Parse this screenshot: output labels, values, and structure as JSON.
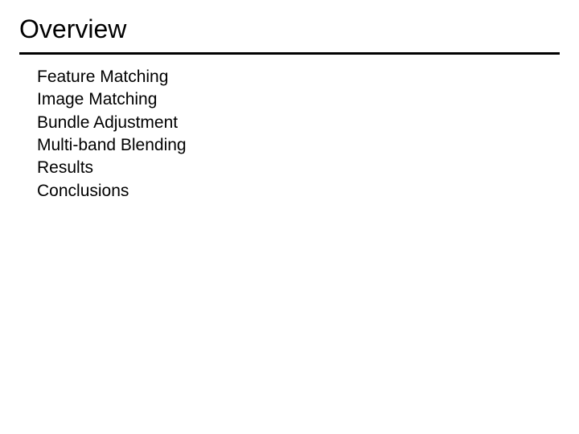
{
  "title": "Overview",
  "items": [
    "Feature Matching",
    "Image Matching",
    "Bundle Adjustment",
    "Multi-band Blending",
    "Results",
    "Conclusions"
  ]
}
